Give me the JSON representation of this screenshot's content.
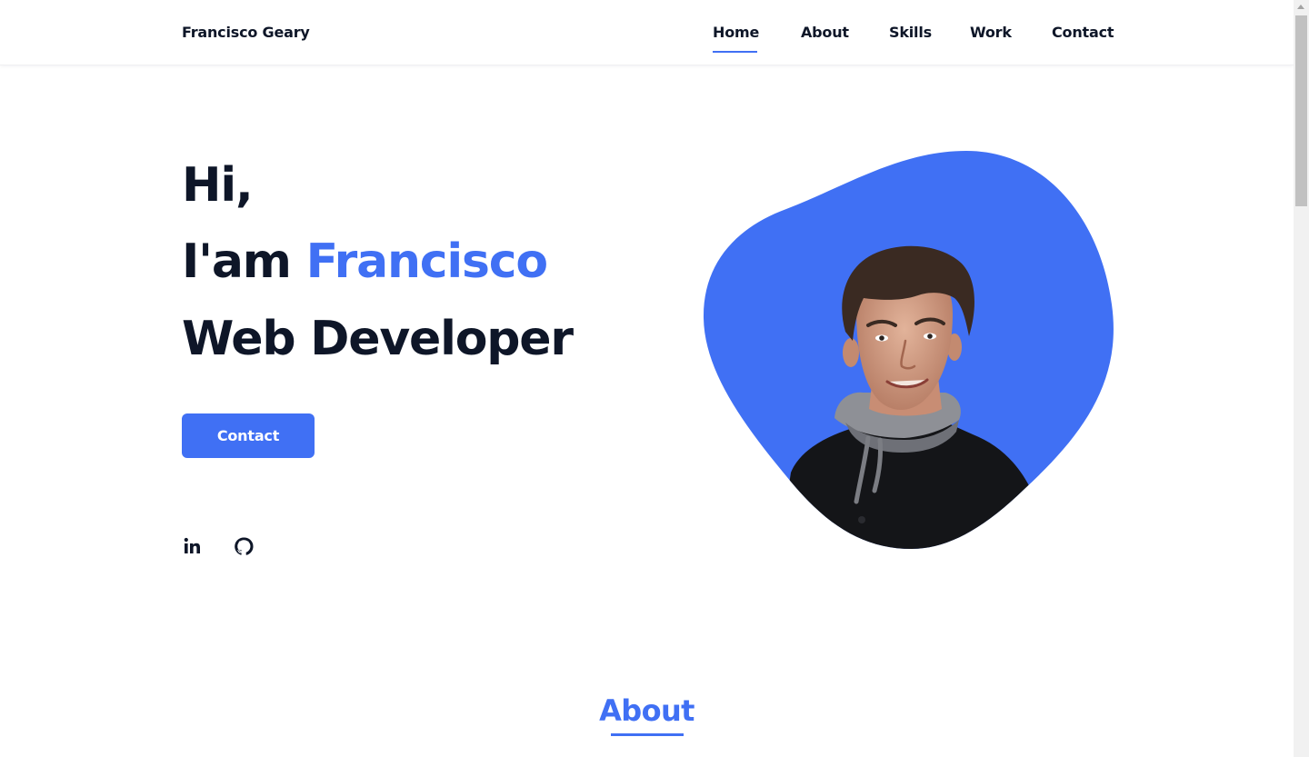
{
  "header": {
    "logo": "Francisco Geary",
    "nav": [
      {
        "label": "Home",
        "active": true
      },
      {
        "label": "About",
        "active": false
      },
      {
        "label": "Skills",
        "active": false
      },
      {
        "label": "Work",
        "active": false
      },
      {
        "label": "Contact",
        "active": false
      }
    ]
  },
  "hero": {
    "greeting": "Hi,",
    "intro_prefix": "I'am",
    "name": "Francisco",
    "role": "Web Developer",
    "button_label": "Contact",
    "social": [
      "linkedin-icon",
      "github-icon"
    ],
    "image": "portrait-photo"
  },
  "about": {
    "title": "About"
  },
  "colors": {
    "accent": "#4070f4",
    "text": "#0e1628",
    "background": "#ffffff"
  }
}
